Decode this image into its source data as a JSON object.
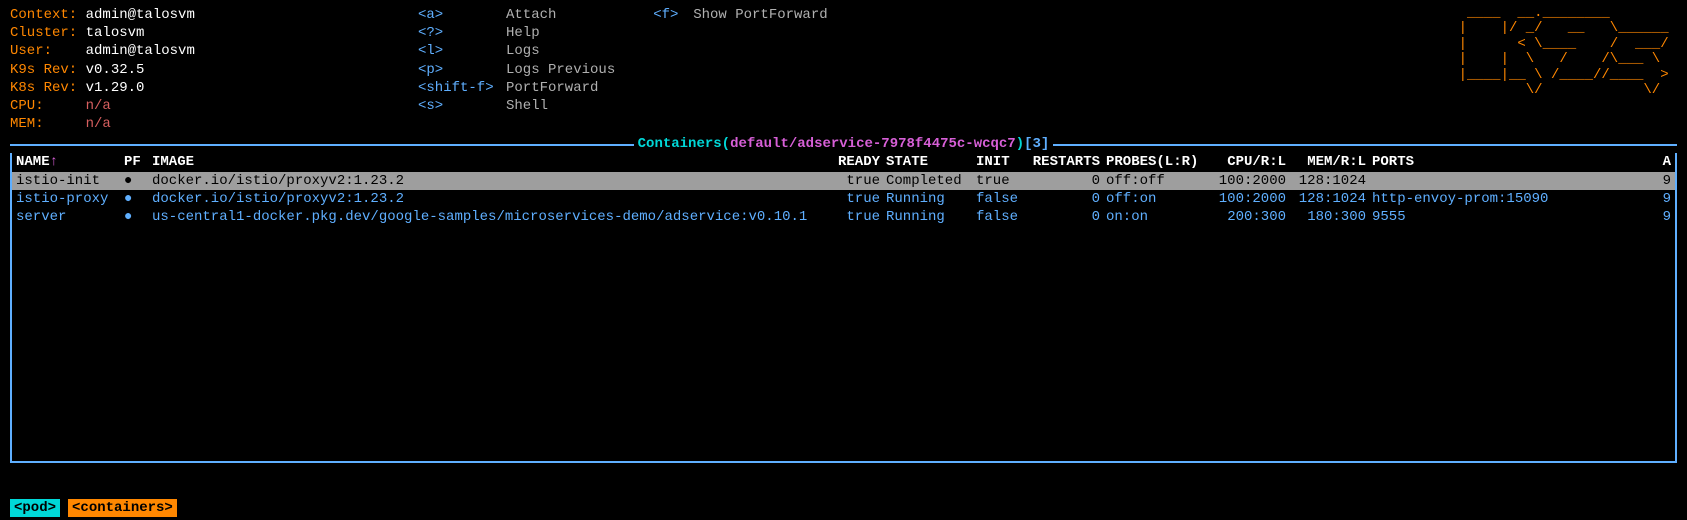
{
  "info": {
    "context_label": "Context:",
    "context_value": "admin@talosvm",
    "cluster_label": "Cluster:",
    "cluster_value": "talosvm",
    "user_label": "User:",
    "user_value": "admin@talosvm",
    "k9s_label": "K9s Rev:",
    "k9s_value": "v0.32.5",
    "k8s_label": "K8s Rev:",
    "k8s_value": "v1.29.0",
    "cpu_label": "CPU:",
    "cpu_value": "n/a",
    "mem_label": "MEM:",
    "mem_value": "n/a"
  },
  "shortcuts1": [
    {
      "key": "<a>",
      "label": "Attach"
    },
    {
      "key": "<?>",
      "label": "Help"
    },
    {
      "key": "<l>",
      "label": "Logs"
    },
    {
      "key": "<p>",
      "label": "Logs Previous"
    },
    {
      "key": "<shift-f>",
      "label": "PortForward"
    },
    {
      "key": "<s>",
      "label": "Shell"
    }
  ],
  "shortcuts2": [
    {
      "key": "<f>",
      "label": "Show PortForward"
    }
  ],
  "title": {
    "main": " Containers(",
    "ns": "default/adservice-7978f4475c-wcqc7",
    "close": ")",
    "count": "[3] "
  },
  "columns": {
    "name": "NAME",
    "sort": "↑",
    "pf": "PF",
    "image": "IMAGE",
    "ready": "READY",
    "state": "STATE",
    "init": "INIT",
    "restarts": "RESTARTS",
    "probes": "PROBES(L:R)",
    "cpu": "CPU/R:L",
    "mem": "MEM/R:L",
    "ports": "PORTS",
    "a": "A"
  },
  "rows": [
    {
      "name": "istio-init",
      "pf": "●",
      "image": "docker.io/istio/proxyv2:1.23.2",
      "ready": "true",
      "state": "Completed",
      "init": "true",
      "restarts": "0",
      "probes": "off:off",
      "cpu": "100:2000",
      "mem": "128:1024",
      "ports": "",
      "a": "9"
    },
    {
      "name": "istio-proxy",
      "pf": "●",
      "image": "docker.io/istio/proxyv2:1.23.2",
      "ready": "true",
      "state": "Running",
      "init": "false",
      "restarts": "0",
      "probes": "off:on",
      "cpu": "100:2000",
      "mem": "128:1024",
      "ports": "http-envoy-prom:15090",
      "a": "9"
    },
    {
      "name": "server",
      "pf": "●",
      "image": "us-central1-docker.pkg.dev/google-samples/microservices-demo/adservice:v0.10.1",
      "ready": "true",
      "state": "Running",
      "init": "false",
      "restarts": "0",
      "probes": "on:on",
      "cpu": "200:300",
      "mem": "180:300",
      "ports": "9555",
      "a": "9"
    }
  ],
  "breadcrumbs": {
    "pod": "<pod>",
    "containers": "<containers>"
  },
  "logo": " ____  __.________        \n|    |/ _/   __   \\______ \n|      < \\____    /  ___/ \n|    |  \\   /    /\\___ \\  \n|____|__ \\ /____//____  > \n        \\/            \\/  "
}
